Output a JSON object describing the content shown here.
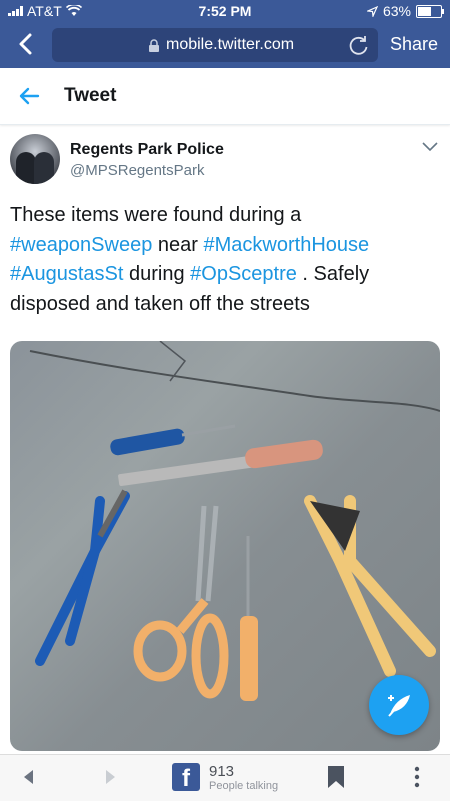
{
  "status_bar": {
    "carrier": "AT&T",
    "time": "7:52 PM",
    "battery": "63%",
    "battery_level": 0.63
  },
  "browser": {
    "url": "mobile.twitter.com",
    "share_label": "Share"
  },
  "header": {
    "title": "Tweet"
  },
  "tweet": {
    "display_name": "Regents Park Police",
    "handle": "@MPSRegentsPark",
    "text": {
      "t1": "These items were found during a ",
      "h1": "#weaponSweep",
      "t2": " near ",
      "h2": "#MackworthHouse",
      "t3": " ",
      "h3": "#AugustasSt",
      "t4": " during ",
      "h4": "#OpSceptre",
      "t5": " . Safely disposed and taken off the streets"
    }
  },
  "bottom_bar": {
    "count": "913",
    "count_label": "People talking",
    "fb_letter": "f"
  },
  "colors": {
    "facebook_blue": "#3b5998",
    "twitter_blue": "#1da1f2",
    "hashtag": "#1b95e0"
  }
}
